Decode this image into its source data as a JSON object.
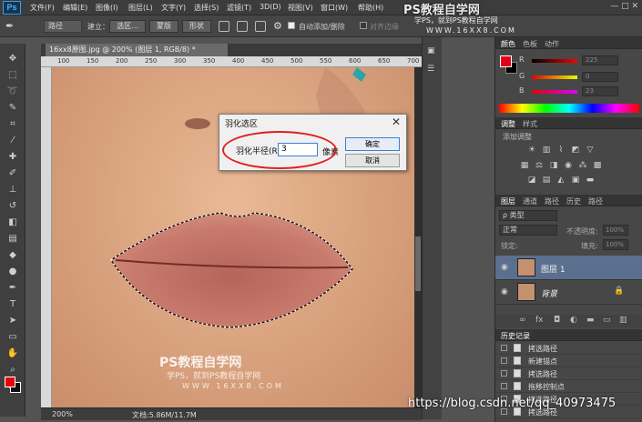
{
  "app": {
    "logo": "Ps",
    "menu": [
      "文件(F)",
      "编辑(E)",
      "图像(I)",
      "图层(L)",
      "文字(Y)",
      "选择(S)",
      "滤镜(T)",
      "3D(D)",
      "视图(V)",
      "窗口(W)",
      "帮助(H)"
    ],
    "window_controls": "— □ ✕"
  },
  "options_bar": {
    "mode_value": "路径",
    "build_label": "建立：",
    "selection_btn": "选区...",
    "mask_btn": "蒙版",
    "shape_btn": "形状",
    "auto_add_delete": "自动添加/删除",
    "align_edges": "对齐边缘"
  },
  "document": {
    "tab_title": "16xx8原图.jpg @ 200% (图层 1, RGB/8) *",
    "ruler_top": [
      "100",
      "150",
      "200",
      "250",
      "300",
      "350",
      "400",
      "450",
      "500",
      "550",
      "600",
      "650",
      "700"
    ],
    "zoom": "200%",
    "doc_size": "文档:5.86M/11.7M"
  },
  "dialog": {
    "title": "羽化选区",
    "label": "羽化半径(R):",
    "value": "3",
    "unit": "像素",
    "ok": "确定",
    "cancel": "取消"
  },
  "panels": {
    "color_tabs": [
      "颜色",
      "色板",
      "动作"
    ],
    "r_label": "R",
    "g_label": "G",
    "b_label": "B",
    "r_value": "225",
    "g_value": "0",
    "b_value": "23",
    "fg_color": "#e10017",
    "adjust_tabs": [
      "调整",
      "样式"
    ],
    "adjust_title": "添加调整",
    "layers_tabs": [
      "图层",
      "通道",
      "路径",
      "历史",
      "路径"
    ],
    "kind_label": "ρ 类型",
    "blend_mode": "正常",
    "opacity_label": "不透明度:",
    "opacity_value": "100%",
    "lock_label": "锁定:",
    "fill_label": "填充:",
    "fill_value": "100%",
    "layers": [
      {
        "name": "图层 1"
      },
      {
        "name": "背景"
      }
    ],
    "history_title": "历史记录",
    "history": [
      "拷选路径",
      "新建锚点",
      "拷选路径",
      "拖移控制点",
      "拷选路径",
      "拷选路径"
    ]
  },
  "watermarks": {
    "top_title": "PS教程自学网",
    "top_sub": "学PS，就到PS教程自学网",
    "top_url": "WWW.16XX8.COM",
    "canvas_title": "PS教程自学网",
    "canvas_sub": "学PS，就到PS教程自学网",
    "canvas_url": "WWW.16XX8.COM",
    "blog": "https://blog.csdn.net/qq_40973475"
  }
}
